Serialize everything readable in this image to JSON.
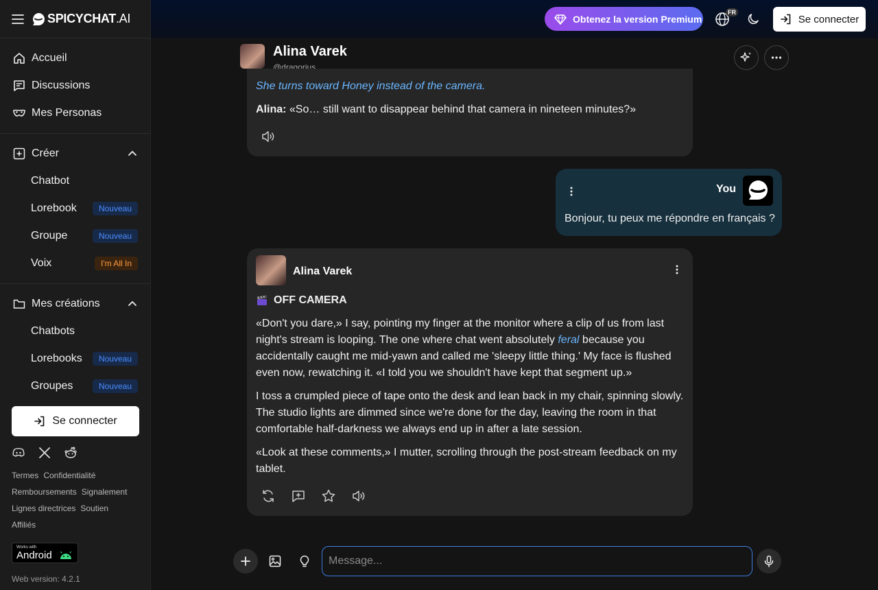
{
  "brand": {
    "name": "SPICYCHAT",
    "suffix": ".AI"
  },
  "sidebar": {
    "main_nav": [
      {
        "label": "Accueil",
        "icon": "home-icon"
      },
      {
        "label": "Discussions",
        "icon": "chat-icon"
      },
      {
        "label": "Mes Personas",
        "icon": "mask-icon"
      }
    ],
    "create": {
      "label": "Créer",
      "items": [
        {
          "label": "Chatbot",
          "badge": ""
        },
        {
          "label": "Lorebook",
          "badge": "Nouveau"
        },
        {
          "label": "Groupe",
          "badge": "Nouveau"
        },
        {
          "label": "Voix",
          "badge": "I'm All In"
        }
      ]
    },
    "creations": {
      "label": "Mes créations",
      "items": [
        {
          "label": "Chatbots",
          "badge": ""
        },
        {
          "label": "Lorebooks",
          "badge": "Nouveau"
        },
        {
          "label": "Groupes",
          "badge": "Nouveau"
        }
      ]
    },
    "signin": "Se connecter",
    "links": [
      "Termes",
      "Confidentialité",
      "Remboursements",
      "Signalement",
      "Lignes directrices",
      "Soutien",
      "Affiliés"
    ],
    "android": {
      "small": "Works with",
      "big": "Android"
    },
    "version": "Web version: 4.2.1"
  },
  "topbar": {
    "premium": "Obtenez la version Premium",
    "lang_badge": "FR",
    "signin": "Se connecter"
  },
  "chat": {
    "name": "Alina Varek",
    "handle": "@dragorius"
  },
  "messages": {
    "m1": {
      "italic": "She turns toward Honey instead of the camera.",
      "speaker": "Alina:",
      "text": " «So… still want to disappear behind that camera in nineteen minutes?»"
    },
    "user": {
      "name": "You",
      "text": "Bonjour, tu peux me répondre en français ?"
    },
    "m2": {
      "name": "Alina Varek",
      "heading": "OFF CAMERA",
      "p1_a": "«Don't you dare,» I say, pointing my finger at the monitor where a clip of us from last night's stream is looping. The one where chat went absolutely ",
      "p1_em": "feral",
      "p1_b": " because you accidentally caught me mid-yawn and called me 'sleepy little thing.' My face is flushed even now, rewatching it. «I told you we shouldn't have kept that segment up.»",
      "p2": "I toss a crumpled piece of tape onto the desk and lean back in my chair, spinning slowly. The studio lights are dimmed since we're done for the day, leaving the room in that comfortable half-darkness we always end up in after a late session.",
      "p3": "«Look at these comments,» I mutter, scrolling through the post-stream feedback on my tablet."
    }
  },
  "composer": {
    "placeholder": "Message..."
  },
  "colors": {
    "accent_blue": "#3f7de0",
    "premium_start": "#9a4bea",
    "premium_end": "#5b6cf0",
    "italic": "#6ab6ff"
  }
}
